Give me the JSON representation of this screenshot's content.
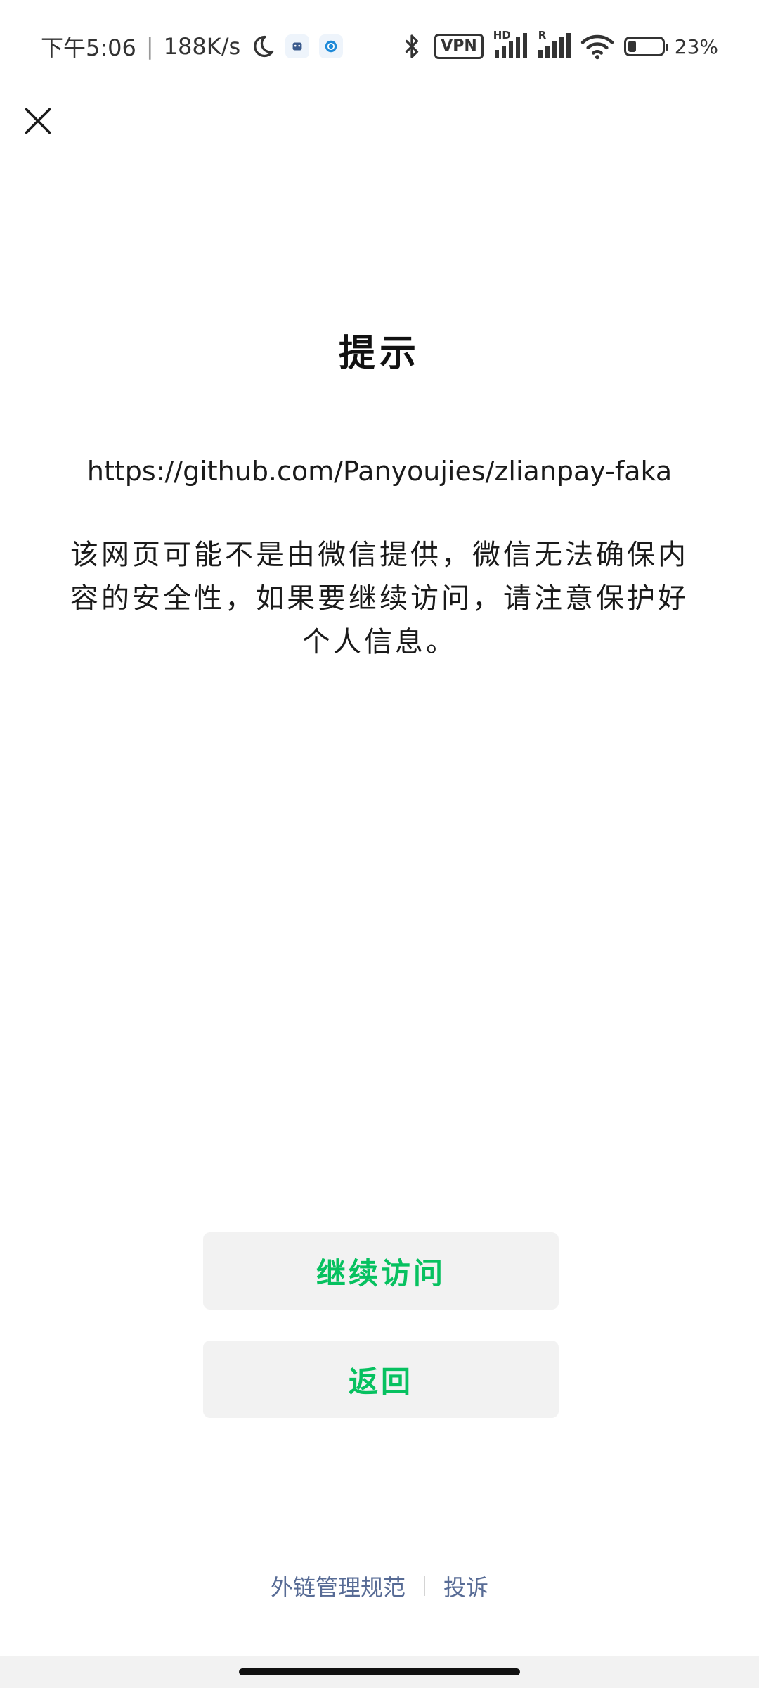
{
  "status_bar": {
    "time": "下午5:06",
    "network_speed": "188K/s",
    "vpn_label": "VPN",
    "hd_label": "HD",
    "roaming_label": "R",
    "battery_percent": "23%",
    "battery_level": 0.23,
    "icons": [
      "moon-icon",
      "app-notification-icon",
      "app-notification-icon-2",
      "bluetooth-icon",
      "vpn-icon",
      "signal-icon",
      "signal-icon-2",
      "wifi-icon",
      "battery-icon"
    ]
  },
  "nav": {
    "close_icon": "close-icon"
  },
  "main": {
    "title": "提示",
    "url": "https://github.com/Panyoujies/zlianpay-faka",
    "description": "该网页可能不是由微信提供，微信无法确保内容的安全性，如果要继续访问，请注意保护好个人信息。"
  },
  "buttons": {
    "continue_label": "继续访问",
    "back_label": "返回"
  },
  "footer": {
    "rules_link": "外链管理规范",
    "complaint_link": "投诉"
  },
  "colors": {
    "accent": "#07c160",
    "link": "#576b95",
    "button_bg": "#f2f2f2"
  }
}
